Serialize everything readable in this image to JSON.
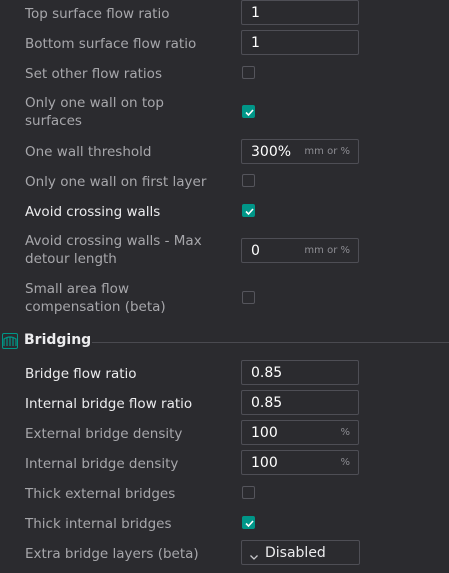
{
  "colors": {
    "background": "#2b2b2f",
    "accent": "#009688",
    "label_dim": "#a7a7ab",
    "label_bright": "#ececee"
  },
  "settings": {
    "top_surface_flow_ratio": {
      "label": "Top surface flow ratio",
      "value": "1"
    },
    "bottom_surface_flow_ratio": {
      "label": "Bottom surface flow ratio",
      "value": "1"
    },
    "set_other_flow_ratios": {
      "label": "Set other flow ratios",
      "checked": false
    },
    "only_one_wall_top": {
      "label": "Only one wall on top surfaces",
      "checked": true
    },
    "one_wall_threshold": {
      "label": "One wall threshold",
      "value": "300%",
      "unit": "mm or %"
    },
    "only_one_wall_first_layer": {
      "label": "Only one wall on first layer",
      "checked": false
    },
    "avoid_crossing_walls": {
      "label": "Avoid crossing walls",
      "checked": true
    },
    "avoid_crossing_walls_max_detour": {
      "label": "Avoid crossing walls - Max detour length",
      "value": "0",
      "unit": "mm or %"
    },
    "small_area_flow_compensation": {
      "label": "Small area flow compensation (beta)",
      "checked": false
    }
  },
  "bridging": {
    "section_title": "Bridging",
    "section_icon": "bridge-icon",
    "bridge_flow_ratio": {
      "label": "Bridge flow ratio",
      "value": "0.85"
    },
    "internal_bridge_flow_ratio": {
      "label": "Internal bridge flow ratio",
      "value": "0.85"
    },
    "external_bridge_density": {
      "label": "External bridge density",
      "value": "100",
      "unit": "%"
    },
    "internal_bridge_density": {
      "label": "Internal bridge density",
      "value": "100",
      "unit": "%"
    },
    "thick_external_bridges": {
      "label": "Thick external bridges",
      "checked": false
    },
    "thick_internal_bridges": {
      "label": "Thick internal bridges",
      "checked": true
    },
    "extra_bridge_layers": {
      "label": "Extra bridge layers (beta)",
      "value": "Disabled",
      "icon": "chevron-down-icon"
    }
  }
}
